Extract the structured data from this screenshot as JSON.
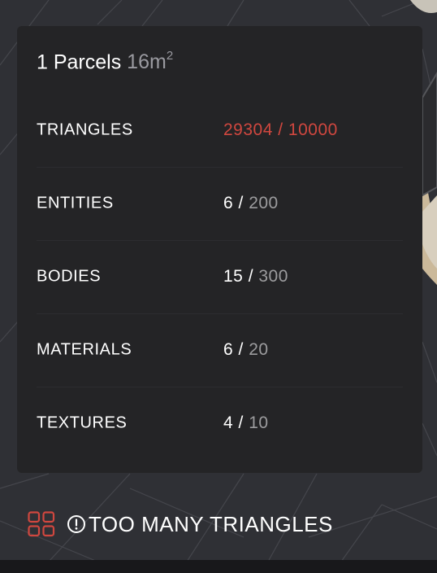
{
  "panel": {
    "parcel_count": "1 Parcels",
    "area_value": "16m",
    "area_exponent": "2"
  },
  "stats": [
    {
      "label": "TRIANGLES",
      "current": "29304",
      "separator": " / ",
      "limit": "10000",
      "exceeded": true
    },
    {
      "label": "ENTITIES",
      "current": "6",
      "separator": " / ",
      "limit": "200",
      "exceeded": false
    },
    {
      "label": "BODIES",
      "current": "15",
      "separator": " / ",
      "limit": "300",
      "exceeded": false
    },
    {
      "label": "MATERIALS",
      "current": "6",
      "separator": " / ",
      "limit": "20",
      "exceeded": false
    },
    {
      "label": "TEXTURES",
      "current": "4",
      "separator": " / ",
      "limit": "10",
      "exceeded": false
    }
  ],
  "footer": {
    "grid_icon": "grid-icon",
    "warning_icon": "warning-circle-icon",
    "warning_text": "TOO MANY TRIANGLES"
  },
  "colors": {
    "error": "#d0473f",
    "panel_bg": "#242426",
    "muted": "#9c9c9e"
  }
}
